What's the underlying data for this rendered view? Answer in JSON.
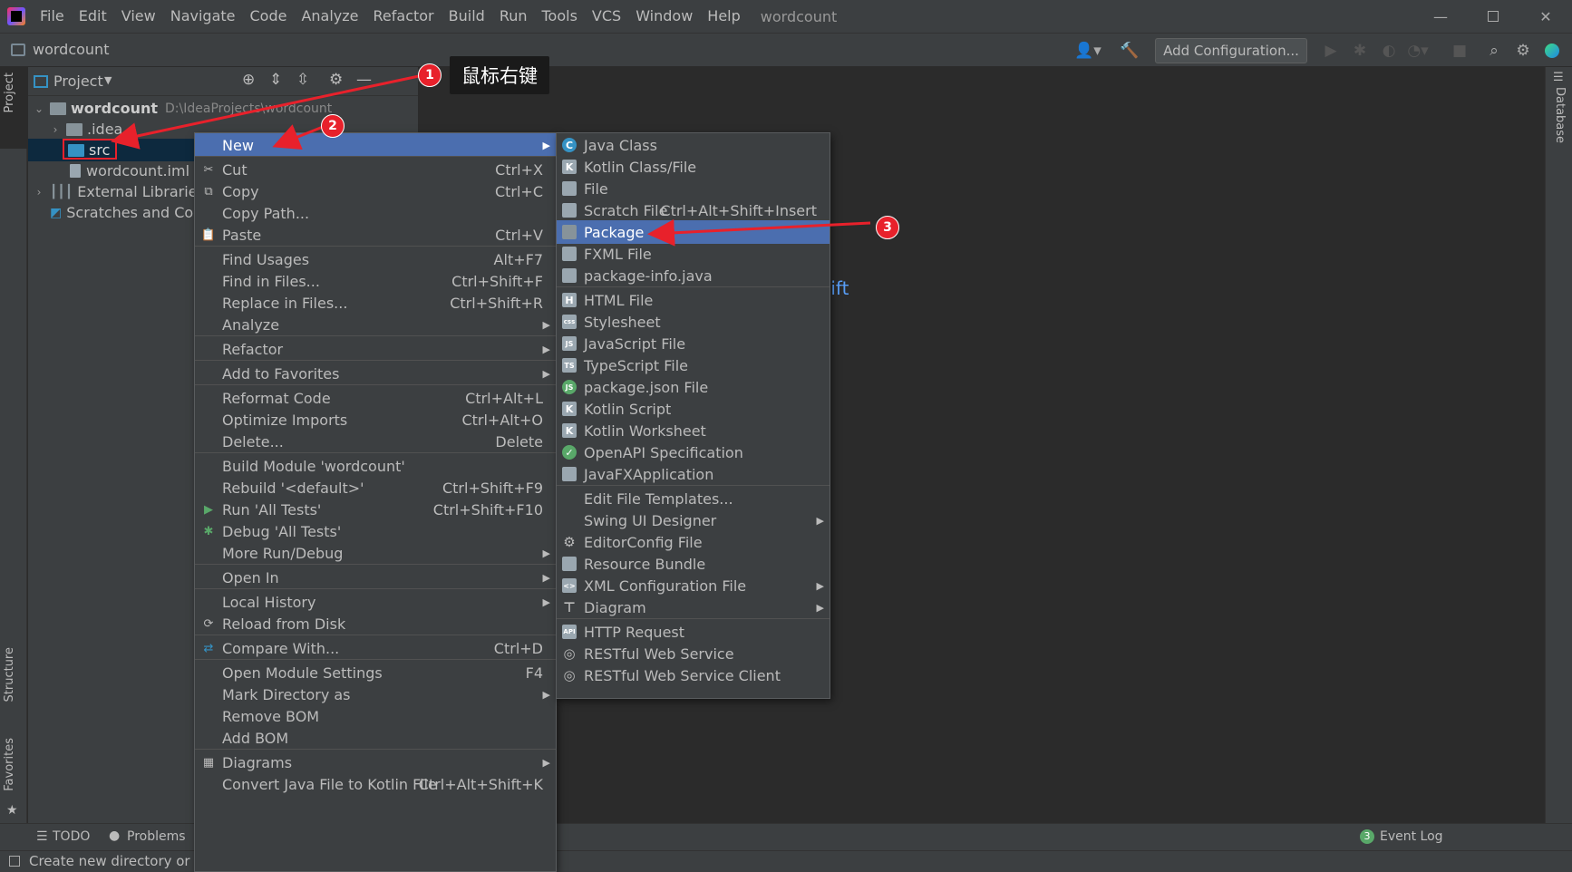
{
  "title_bar": {
    "menus": [
      "File",
      "Edit",
      "View",
      "Navigate",
      "Code",
      "Analyze",
      "Refactor",
      "Build",
      "Run",
      "Tools",
      "VCS",
      "Window",
      "Help"
    ],
    "window_title": "wordcount"
  },
  "nav_bar": {
    "breadcrumb": "wordcount",
    "add_configuration": "Add Configuration..."
  },
  "side_tabs": {
    "left": [
      "Project",
      "Structure",
      "Favorites"
    ],
    "right": [
      "Database"
    ]
  },
  "project_panel": {
    "header": "Project",
    "tree": [
      {
        "label": "wordcount",
        "path": "D:\\IdeaProjects\\wordcount"
      },
      {
        "label": ".idea"
      },
      {
        "label": "src"
      },
      {
        "label": "wordcount.iml"
      },
      {
        "label": "External Libraries"
      },
      {
        "label": "Scratches and Consoles"
      }
    ]
  },
  "editor_hints": {
    "shift_text": "Shift",
    "n_text": "n"
  },
  "context_menu": {
    "items": [
      {
        "label": "New",
        "shortcut": "",
        "submenu": true
      },
      {
        "label": "Cut",
        "shortcut": "Ctrl+X"
      },
      {
        "label": "Copy",
        "shortcut": "Ctrl+C"
      },
      {
        "label": "Copy Path...",
        "shortcut": ""
      },
      {
        "label": "Paste",
        "shortcut": "Ctrl+V"
      },
      {
        "label": "Find Usages",
        "shortcut": "Alt+F7"
      },
      {
        "label": "Find in Files...",
        "shortcut": "Ctrl+Shift+F"
      },
      {
        "label": "Replace in Files...",
        "shortcut": "Ctrl+Shift+R"
      },
      {
        "label": "Analyze",
        "shortcut": "",
        "submenu": true
      },
      {
        "label": "Refactor",
        "shortcut": "",
        "submenu": true
      },
      {
        "label": "Add to Favorites",
        "shortcut": "",
        "submenu": true
      },
      {
        "label": "Reformat Code",
        "shortcut": "Ctrl+Alt+L"
      },
      {
        "label": "Optimize Imports",
        "shortcut": "Ctrl+Alt+O"
      },
      {
        "label": "Delete...",
        "shortcut": "Delete"
      },
      {
        "label": "Build Module 'wordcount'",
        "shortcut": ""
      },
      {
        "label": "Rebuild '<default>'",
        "shortcut": "Ctrl+Shift+F9"
      },
      {
        "label": "Run 'All Tests'",
        "shortcut": "Ctrl+Shift+F10"
      },
      {
        "label": "Debug 'All Tests'",
        "shortcut": ""
      },
      {
        "label": "More Run/Debug",
        "shortcut": "",
        "submenu": true
      },
      {
        "label": "Open In",
        "shortcut": "",
        "submenu": true
      },
      {
        "label": "Local History",
        "shortcut": "",
        "submenu": true
      },
      {
        "label": "Reload from Disk",
        "shortcut": ""
      },
      {
        "label": "Compare With...",
        "shortcut": "Ctrl+D"
      },
      {
        "label": "Open Module Settings",
        "shortcut": "F4"
      },
      {
        "label": "Mark Directory as",
        "shortcut": "",
        "submenu": true
      },
      {
        "label": "Remove BOM",
        "shortcut": ""
      },
      {
        "label": "Add BOM",
        "shortcut": ""
      },
      {
        "label": "Diagrams",
        "shortcut": "",
        "submenu": true
      },
      {
        "label": "Convert Java File to Kotlin File",
        "shortcut": "Ctrl+Alt+Shift+K"
      }
    ]
  },
  "new_submenu": {
    "items": [
      {
        "label": "Java Class",
        "icon": "java-class-icon"
      },
      {
        "label": "Kotlin Class/File",
        "icon": "kotlin-file-icon"
      },
      {
        "label": "File",
        "icon": "file-icon"
      },
      {
        "label": "Scratch File",
        "shortcut": "Ctrl+Alt+Shift+Insert",
        "icon": "scratch-file-icon"
      },
      {
        "label": "Package",
        "icon": "package-icon"
      },
      {
        "label": "FXML File",
        "icon": "fxml-file-icon"
      },
      {
        "label": "package-info.java",
        "icon": "java-file-icon"
      },
      {
        "label": "HTML File",
        "icon": "html-file-icon"
      },
      {
        "label": "Stylesheet",
        "icon": "css-file-icon"
      },
      {
        "label": "JavaScript File",
        "icon": "js-file-icon"
      },
      {
        "label": "TypeScript File",
        "icon": "ts-file-icon"
      },
      {
        "label": "package.json File",
        "icon": "npm-file-icon"
      },
      {
        "label": "Kotlin Script",
        "icon": "kotlin-script-icon"
      },
      {
        "label": "Kotlin Worksheet",
        "icon": "kotlin-worksheet-icon"
      },
      {
        "label": "OpenAPI Specification",
        "icon": "openapi-icon"
      },
      {
        "label": "JavaFXApplication",
        "icon": "javafx-icon"
      },
      {
        "label": "Edit File Templates...",
        "icon": ""
      },
      {
        "label": "Swing UI Designer",
        "icon": "",
        "submenu": true
      },
      {
        "label": "EditorConfig File",
        "icon": "gear-icon"
      },
      {
        "label": "Resource Bundle",
        "icon": "resource-bundle-icon"
      },
      {
        "label": "XML Configuration File",
        "icon": "xml-file-icon",
        "submenu": true
      },
      {
        "label": "Diagram",
        "icon": "diagram-icon",
        "submenu": true
      },
      {
        "label": "HTTP Request",
        "icon": "api-file-icon"
      },
      {
        "label": "RESTful Web Service",
        "icon": "globe-icon"
      },
      {
        "label": "RESTful Web Service Client",
        "icon": "globe-client-icon"
      }
    ]
  },
  "annotations": {
    "callout_text": "鼠标右键",
    "badge1": "1",
    "badge2": "2",
    "badge3": "3"
  },
  "bottom_bar": {
    "todo": "TODO",
    "problems": "Problems",
    "event_log": "Event Log",
    "event_count": "3"
  },
  "status_bar": {
    "message": "Create new directory or pa"
  },
  "colors": {
    "highlight": "#4b6eaf",
    "annotation_red": "#e8212b",
    "link_blue": "#589df6"
  }
}
